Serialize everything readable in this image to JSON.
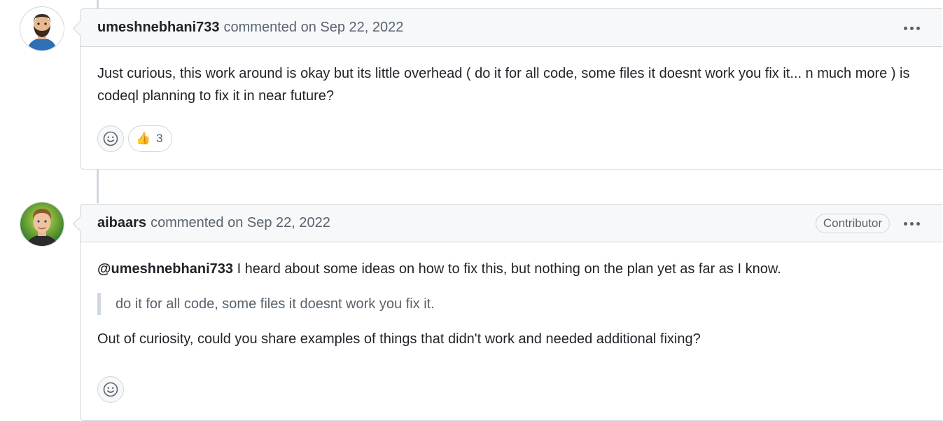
{
  "comments": [
    {
      "author": "umeshnebhani733",
      "meta": "commented on Sep 22, 2022",
      "body": "Just curious, this work around is okay but its little overhead ( do it for all code, some files it doesnt work you fix it... n much more ) is codeql planning to fix it in near future?",
      "reaction": {
        "emoji": "👍",
        "count": "3"
      }
    },
    {
      "author": "aibaars",
      "meta": "commented on Sep 22, 2022",
      "badge": "Contributor",
      "mention": "@umeshnebhani733",
      "body_after_mention": " I heard about some ideas on how to fix this, but nothing on the plan yet as far as I know.",
      "quote": "do it for all code, some files it doesnt work you fix it.",
      "body2": "Out of curiosity, could you share examples of things that didn't work and needed additional fixing?"
    }
  ],
  "icons": {
    "menu": "kebab-horizontal-icon",
    "add_reaction": "smiley-icon"
  },
  "colors": {
    "border": "#d0d7de",
    "header_bg": "#f6f8fa",
    "muted_text": "#59636e",
    "text": "#1f2328"
  }
}
